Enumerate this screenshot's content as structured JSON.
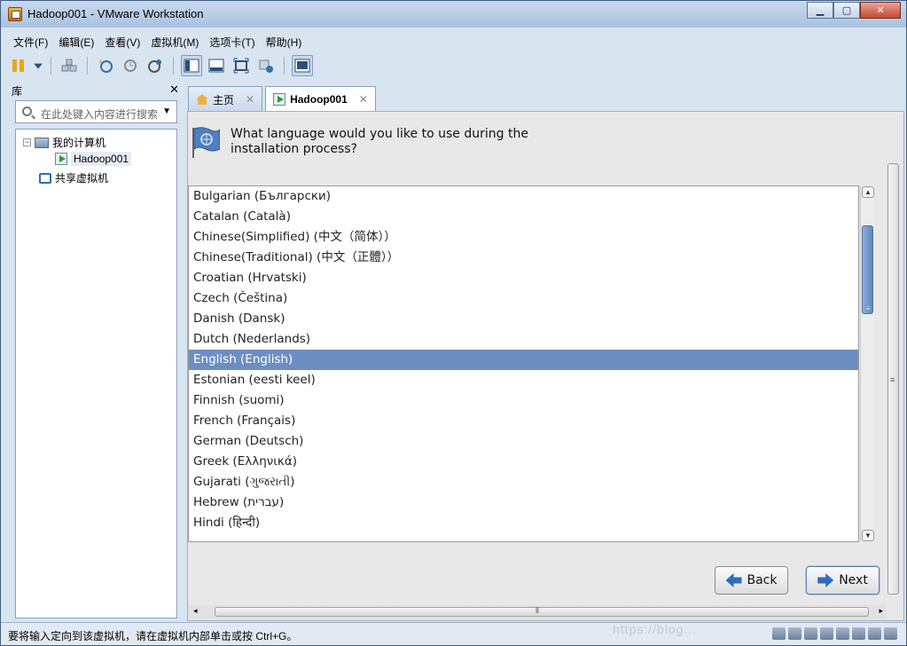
{
  "window": {
    "title": "Hadoop001 - VMware Workstation"
  },
  "menu": [
    "文件(F)",
    "编辑(E)",
    "查看(V)",
    "虚拟机(M)",
    "选项卡(T)",
    "帮助(H)"
  ],
  "library": {
    "title": "库",
    "search_placeholder": "在此处键入内容进行搜索",
    "tree": {
      "my_computer": "我的计算机",
      "vm": "Hadoop001",
      "shared": "共享虚拟机"
    }
  },
  "tabs": [
    {
      "label": "主页"
    },
    {
      "label": "Hadoop001"
    }
  ],
  "installer": {
    "question_line1": "What language would you like to use during the",
    "question_line2": "installation process?",
    "languages": [
      "Bulgarian (Български)",
      "Catalan (Català)",
      "Chinese(Simplified) (中文（简体））",
      "Chinese(Traditional) (中文（正體））",
      "Croatian (Hrvatski)",
      "Czech (Čeština)",
      "Danish (Dansk)",
      "Dutch (Nederlands)",
      "English (English)",
      "Estonian (eesti keel)",
      "Finnish (suomi)",
      "French (Français)",
      "German (Deutsch)",
      "Greek (Ελληνικά)",
      "Gujarati (ગુજરાતી)",
      "Hebrew (עברית)",
      "Hindi (हिन्दी)"
    ],
    "selected": "English (English)",
    "back_label": "Back",
    "next_label": "Next"
  },
  "status": {
    "text": "要将输入定向到该虚拟机，请在虚拟机内部单击或按 Ctrl+G。"
  },
  "watermark": "https://blog..."
}
